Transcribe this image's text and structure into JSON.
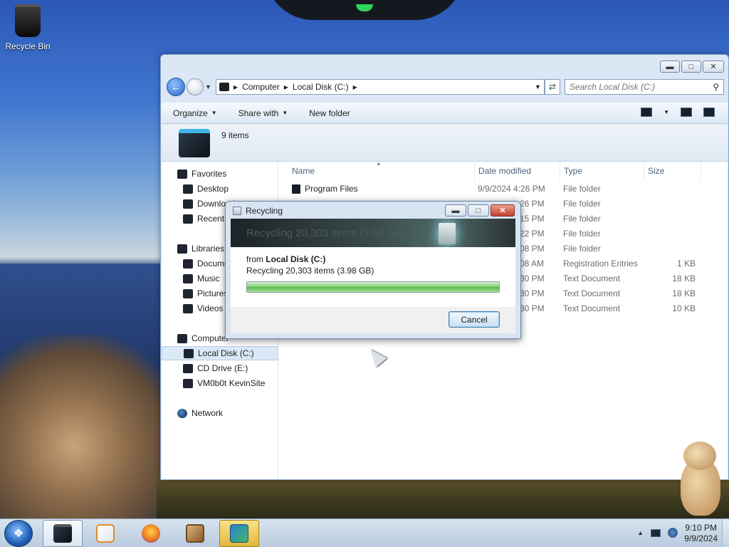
{
  "desktop": {
    "icons": [
      {
        "label": "Recycle Bin"
      }
    ]
  },
  "explorer": {
    "address": {
      "crumbs": [
        "Computer",
        "Local Disk (C:)"
      ],
      "search_placeholder": "Search Local Disk (C:)"
    },
    "toolbar": {
      "organize": "Organize",
      "share_with": "Share with",
      "new_folder": "New folder"
    },
    "details": {
      "items_count": "9 items"
    },
    "nav": {
      "favorites": "Favorites",
      "desktop": "Desktop",
      "downloads": "Downloads",
      "recent": "Recent Places",
      "libraries": "Libraries",
      "documents": "Documents",
      "music": "Music",
      "pictures": "Pictures",
      "videos": "Videos",
      "computer": "Computer",
      "local_disk": "Local Disk (C:)",
      "cd_drive": "CD Drive (E:)",
      "vm_site": "VM0b0t KevinSite",
      "network": "Network"
    },
    "columns": {
      "name": "Name",
      "date": "Date modified",
      "type": "Type",
      "size": "Size"
    },
    "rows": [
      {
        "name": "Program Files",
        "date": "9/9/2024 4:26 PM",
        "type": "File folder",
        "size": ""
      },
      {
        "name": "",
        "date": "26 PM",
        "type": "File folder",
        "size": ""
      },
      {
        "name": "",
        "date": "15 PM",
        "type": "File folder",
        "size": ""
      },
      {
        "name": "",
        "date": "22 PM",
        "type": "File folder",
        "size": ""
      },
      {
        "name": "",
        "date": "08 PM",
        "type": "File folder",
        "size": ""
      },
      {
        "name": "",
        "date": "08 AM",
        "type": "Registration Entries",
        "size": "1 KB"
      },
      {
        "name": "",
        "date": "30 PM",
        "type": "Text Document",
        "size": "18 KB"
      },
      {
        "name": "",
        "date": "30 PM",
        "type": "Text Document",
        "size": "18 KB"
      },
      {
        "name": "",
        "date": "30 PM",
        "type": "Text Document",
        "size": "10 KB"
      }
    ]
  },
  "dialog": {
    "title": "Recycling",
    "banner": "Recycling 20,303 items (3.98 GB)",
    "from_prefix": "from",
    "from_source": "Local Disk (C:)",
    "status": "Recycling 20,303 items (3.98 GB)",
    "progress_percent": 100,
    "cancel": "Cancel"
  },
  "taskbar": {
    "clock_time": "9:10 PM",
    "clock_date": "9/9/2024",
    "apps": [
      "explorer-icon",
      "media-player-icon",
      "firefox-icon",
      "game-icon",
      "app-icon"
    ]
  },
  "colors": {
    "accent": "#3c7fb1",
    "progress": "#5cb84d"
  }
}
